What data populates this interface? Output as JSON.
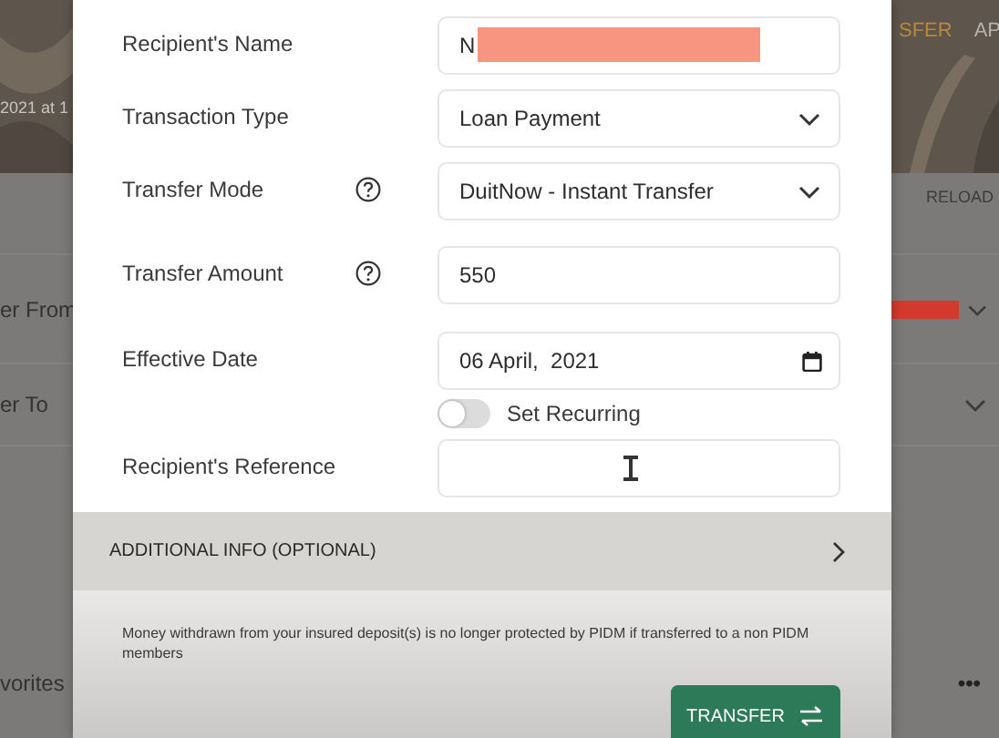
{
  "background_page": {
    "header_text": "2021 at 1",
    "tabs": [
      {
        "label": "SFER",
        "selected": true
      },
      {
        "label": "AP",
        "selected": false
      }
    ],
    "reload": "RELOAD",
    "rows": [
      {
        "label": "er From",
        "redacted": true
      },
      {
        "label": "er To",
        "redacted": false
      }
    ],
    "favorites": {
      "label": "vorites",
      "more": "•••"
    }
  },
  "form": {
    "fields": [
      {
        "label": "Recipient's Name",
        "kind": "text",
        "value": "N",
        "redacted": true,
        "help": false
      },
      {
        "label": "Transaction Type",
        "kind": "select",
        "value": "Loan Payment",
        "help": false
      },
      {
        "label": "Transfer Mode",
        "kind": "select",
        "value": "DuitNow - Instant Transfer",
        "help": true
      },
      {
        "label": "Transfer Amount",
        "kind": "text",
        "value": "550",
        "help": true
      },
      {
        "label": "Effective Date",
        "kind": "date",
        "value": "06 April,  2021",
        "help": false
      },
      {
        "kind": "toggle",
        "label": "Set Recurring",
        "on": false
      },
      {
        "label": "Recipient's Reference",
        "kind": "text",
        "help": false,
        "cursor": true
      }
    ],
    "additional_info": "ADDITIONAL INFO (OPTIONAL)",
    "note": "Money withdrawn from your insured deposit(s) is no longer protected by PIDM if transferred to a non PIDM members",
    "submit": "TRANSFER"
  }
}
